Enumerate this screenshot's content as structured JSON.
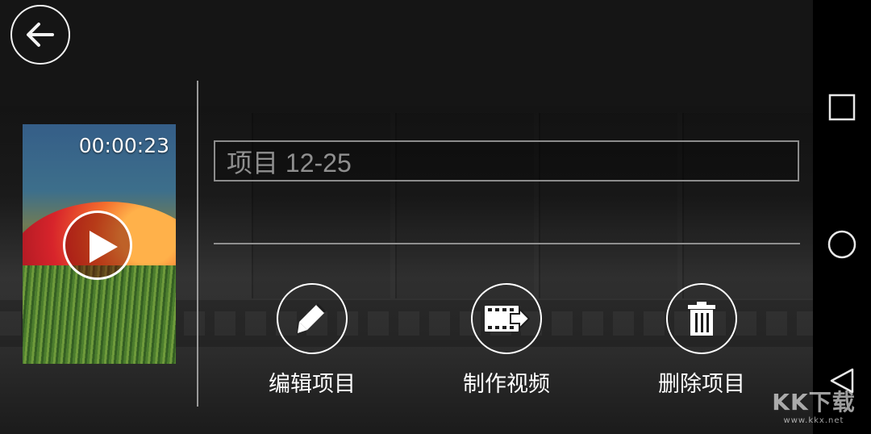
{
  "navigation": {
    "back_icon": "arrow-left-icon"
  },
  "project": {
    "duration": "00:00:23",
    "name": "项目 12-25",
    "thumbnail_icon": "play-icon"
  },
  "actions": [
    {
      "label": "编辑项目",
      "icon": "pencil-icon"
    },
    {
      "label": "制作视频",
      "icon": "film-export-icon"
    },
    {
      "label": "删除项目",
      "icon": "trash-icon"
    }
  ],
  "system_nav": {
    "recent_icon": "square-icon",
    "home_icon": "circle-icon",
    "back_icon": "triangle-back-icon"
  },
  "watermark": {
    "main": "KK下载",
    "sub": "www.kkx.net"
  },
  "colors": {
    "background": "#141414",
    "text": "#ffffff",
    "input_text": "#8f8f8f",
    "nav_bar": "#000000"
  }
}
